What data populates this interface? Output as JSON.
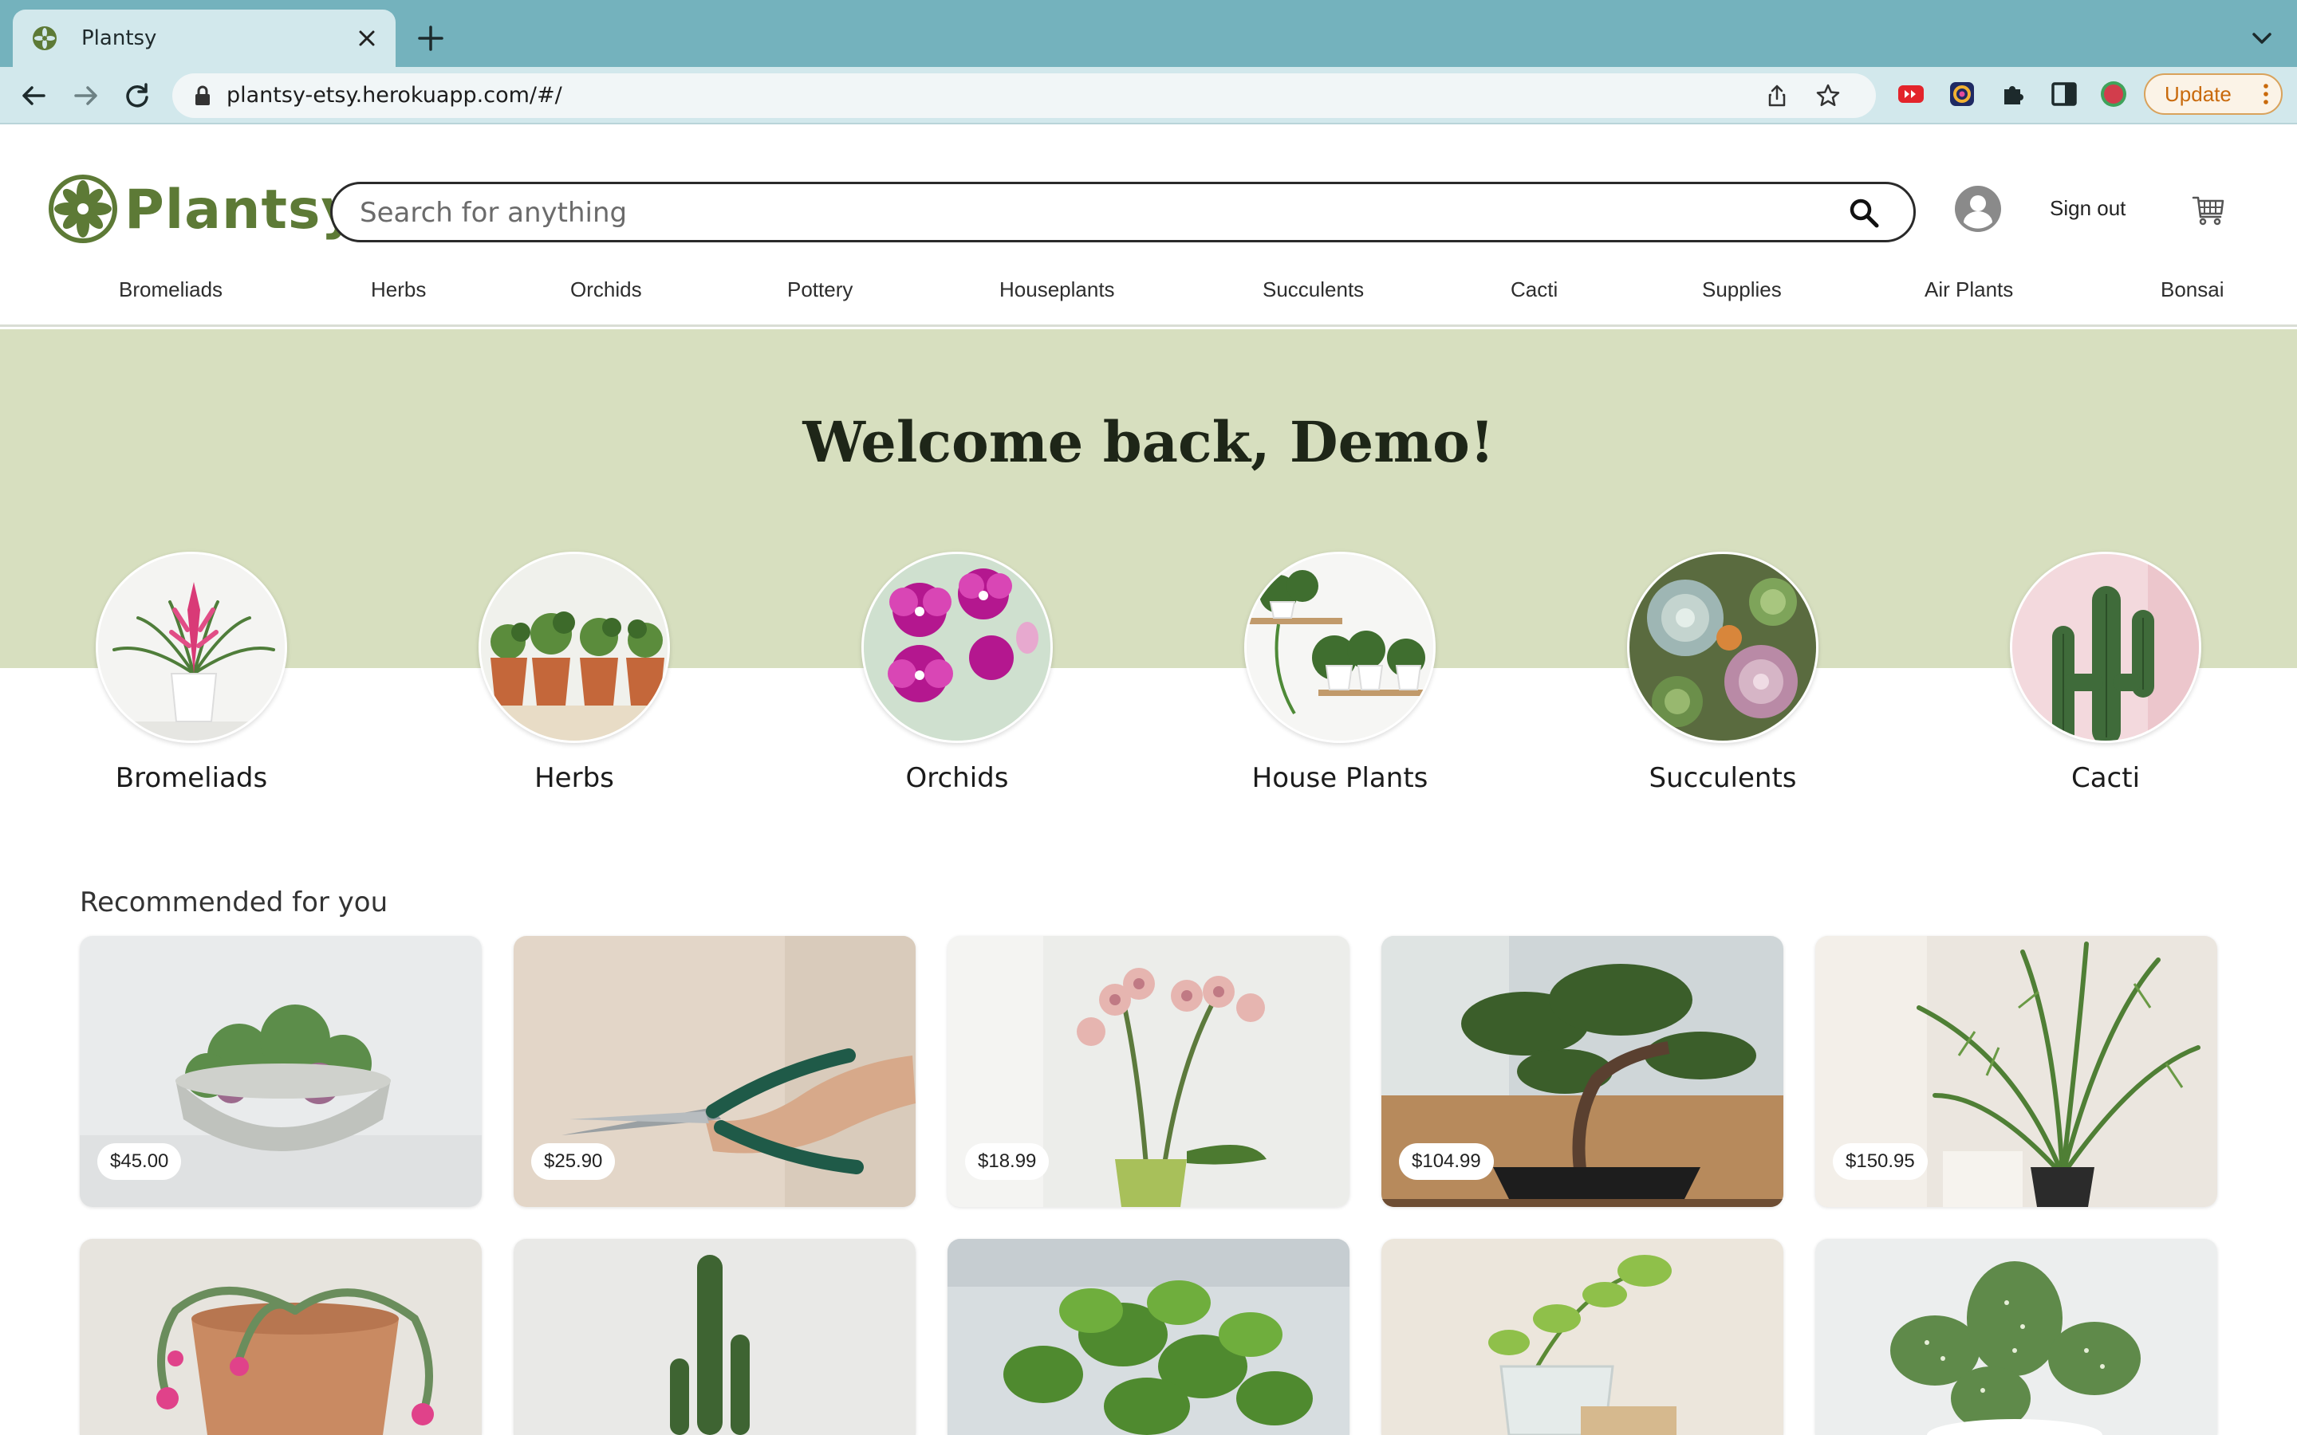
{
  "browser": {
    "tab_title": "Plantsy",
    "url": "plantsy-etsy.herokuapp.com/#/",
    "update_label": "Update"
  },
  "header": {
    "logo_text": "Plantsy",
    "search_placeholder": "Search for anything",
    "signout_label": "Sign out"
  },
  "nav": {
    "items": [
      "Bromeliads",
      "Herbs",
      "Orchids",
      "Pottery",
      "Houseplants",
      "Succulents",
      "Cacti",
      "Supplies",
      "Air Plants",
      "Bonsai"
    ]
  },
  "hero": {
    "welcome": "Welcome back, Demo!",
    "categories": [
      {
        "label": "Bromeliads"
      },
      {
        "label": "Herbs"
      },
      {
        "label": "Orchids"
      },
      {
        "label": "House Plants"
      },
      {
        "label": "Succulents"
      },
      {
        "label": "Cacti"
      }
    ]
  },
  "recommended": {
    "title": "Recommended for you",
    "products": [
      {
        "price": "$45.00"
      },
      {
        "price": "$25.90"
      },
      {
        "price": "$18.99"
      },
      {
        "price": "$104.99"
      },
      {
        "price": "$150.95"
      }
    ]
  },
  "colors": {
    "tabbar": "#74b2bd",
    "toolbar": "#d2e8ec",
    "hero_band": "#d7dfbf",
    "logo_green": "#5d7a36"
  }
}
